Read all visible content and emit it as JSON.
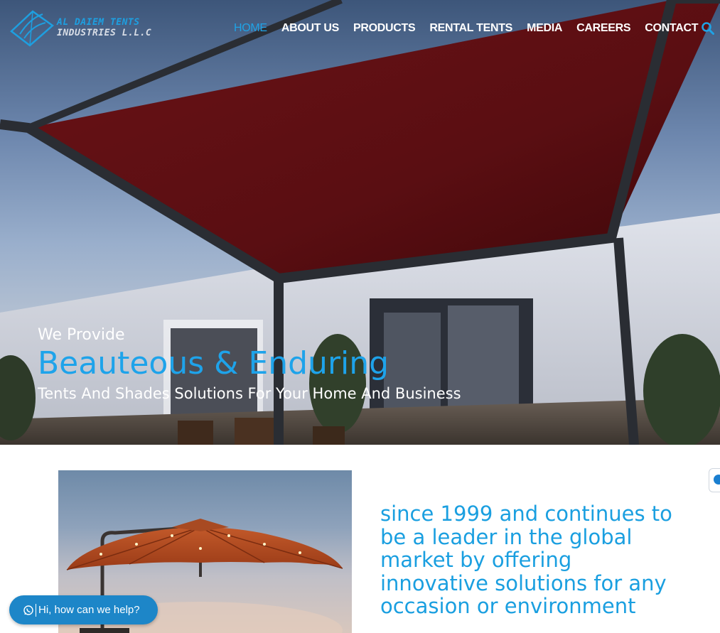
{
  "brand": {
    "line1": "AL DAIEM TENTS",
    "line2": "INDUSTRIES L.L.C"
  },
  "nav": {
    "items": [
      {
        "label": "HOME",
        "active": true
      },
      {
        "label": "ABOUT US",
        "active": false
      },
      {
        "label": "PRODUCTS",
        "active": false
      },
      {
        "label": "RENTAL TENTS",
        "active": false
      },
      {
        "label": "MEDIA",
        "active": false
      },
      {
        "label": "CAREERS",
        "active": false
      },
      {
        "label": "CONTACT",
        "active": false
      }
    ],
    "search_icon": "search-icon"
  },
  "hero": {
    "pre": "We Provide",
    "title": "Beauteous & Enduring",
    "subtitle": "Tents And Shades Solutions For Your Home And Business"
  },
  "about": {
    "text": "since 1999 and continues to be a leader in the global market by offering innovative solutions for any occasion or environment"
  },
  "chat": {
    "icon": "whatsapp-icon",
    "message": "Hi, how can we help?"
  },
  "colors": {
    "accent": "#1fa3e6",
    "canopy": "#5a0f12",
    "frame": "#2a2d33",
    "chat_bg": "#1d86c8"
  }
}
